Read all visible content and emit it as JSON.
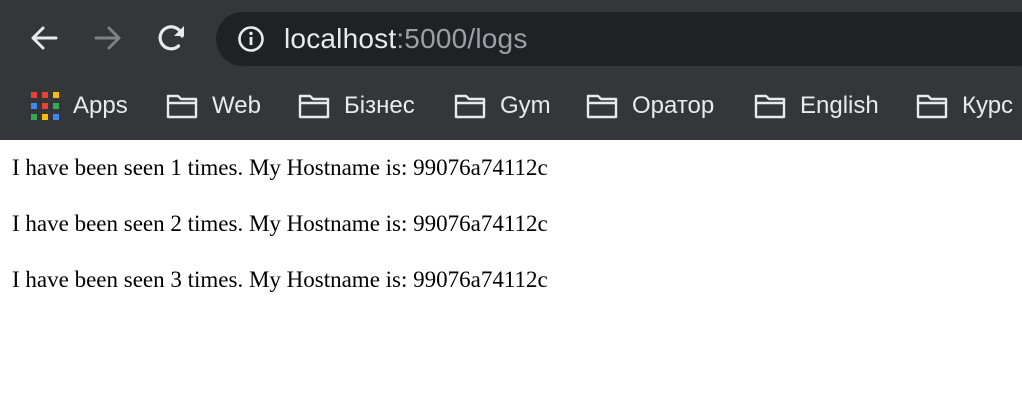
{
  "toolbar": {
    "url_host": "localhost",
    "url_rest": ":5000/logs",
    "colors": {
      "chrome_bg": "#35363a",
      "omnibox_bg": "#202124",
      "text": "#e8eaed",
      "muted_text": "#9aa0a6"
    }
  },
  "bookmarks": {
    "items": [
      {
        "label": "Apps",
        "icon": "apps-grid-icon"
      },
      {
        "label": "Web",
        "icon": "folder-icon"
      },
      {
        "label": "Бізнес",
        "icon": "folder-icon"
      },
      {
        "label": "Gym",
        "icon": "folder-icon"
      },
      {
        "label": "Оратор",
        "icon": "folder-icon"
      },
      {
        "label": "English",
        "icon": "folder-icon"
      },
      {
        "label": "Курс",
        "icon": "folder-icon"
      }
    ]
  },
  "page": {
    "lines": [
      "I have been seen 1 times. My Hostname is: 99076a74112c",
      "I have been seen 2 times. My Hostname is: 99076a74112c",
      "I have been seen 3 times. My Hostname is: 99076a74112c"
    ]
  }
}
